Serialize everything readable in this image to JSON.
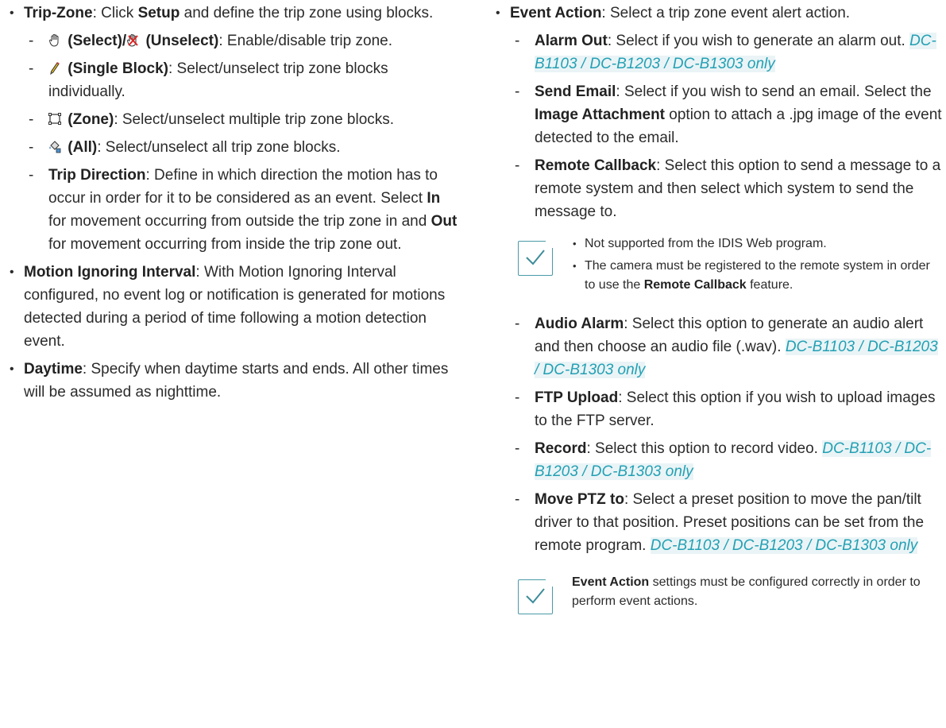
{
  "left": {
    "trip_zone": {
      "label": "Trip-Zone",
      "text1": ": Click ",
      "setup": "Setup",
      "text2": " and define the trip zone using blocks."
    },
    "select": {
      "label1": " (Select)/",
      "label2": " (Unselect)",
      "text": ": Enable/disable trip zone."
    },
    "single_block": {
      "label": " (Single Block)",
      "text": ": Select/unselect trip zone blocks individually."
    },
    "zone": {
      "label": " (Zone)",
      "text": ": Select/unselect multiple trip zone blocks."
    },
    "all": {
      "label": " (All)",
      "text": ": Select/unselect all trip zone blocks."
    },
    "trip_direction": {
      "label": "Trip Direction",
      "text1": ": Define in which direction the motion has to occur in order for it to be considered as an event. Select ",
      "in": "In",
      "text2": " for movement occurring from outside the trip zone in and ",
      "out": "Out",
      "text3": " for movement occurring from inside the trip zone out."
    },
    "motion_ignoring": {
      "label": "Motion Ignoring Interval",
      "text": ": With Motion Ignoring Interval configured, no event log or notification is generated for motions detected during a period of time following a motion detection event."
    },
    "daytime": {
      "label": "Daytime",
      "text": ": Specify when daytime starts and ends. All other times will be assumed as nighttime."
    }
  },
  "right": {
    "event_action": {
      "label": "Event Action",
      "text": ": Select a trip zone event alert action."
    },
    "alarm_out": {
      "label": "Alarm Out",
      "text": ": Select if you wish to generate an alarm out. ",
      "models": "DC-B1103 / DC-B1203 / DC-B1303 only"
    },
    "send_email": {
      "label": "Send Email",
      "text1": ": Select if you wish to send an email. Select the ",
      "attach": "Image Attachment",
      "text2": " option to attach a .jpg image of the event detected to the email."
    },
    "remote_callback": {
      "label": "Remote Callback",
      "text": ": Select this option to send a message to a remote system and then select which system to send the message to."
    },
    "note1": {
      "item1": "Not supported from the IDIS Web program.",
      "item2_a": "The camera must be registered to the remote system in order to use the ",
      "item2_bold": "Remote Callback",
      "item2_b": " feature."
    },
    "audio_alarm": {
      "label": "Audio Alarm",
      "text": ": Select this option to generate an audio alert and then choose an audio file (.wav). ",
      "models": "DC-B1103 / DC-B1203 / DC-B1303 only"
    },
    "ftp_upload": {
      "label": "FTP Upload",
      "text": ": Select this option if you wish to upload images to the FTP server."
    },
    "record": {
      "label": "Record",
      "text": ": Select this option to record video. ",
      "models": "DC-B1103 / DC-B1203 / DC-B1303 only"
    },
    "move_ptz": {
      "label": "Move PTZ to",
      "text": ": Select a preset position to move the pan/tilt driver to that position. Preset positions can be set from the remote program. ",
      "models": "DC-B1103 / DC-B1203 / DC-B1303 only"
    },
    "note2": {
      "bold": "Event Action",
      "text": " settings must be configured correctly in order to perform event actions."
    }
  }
}
